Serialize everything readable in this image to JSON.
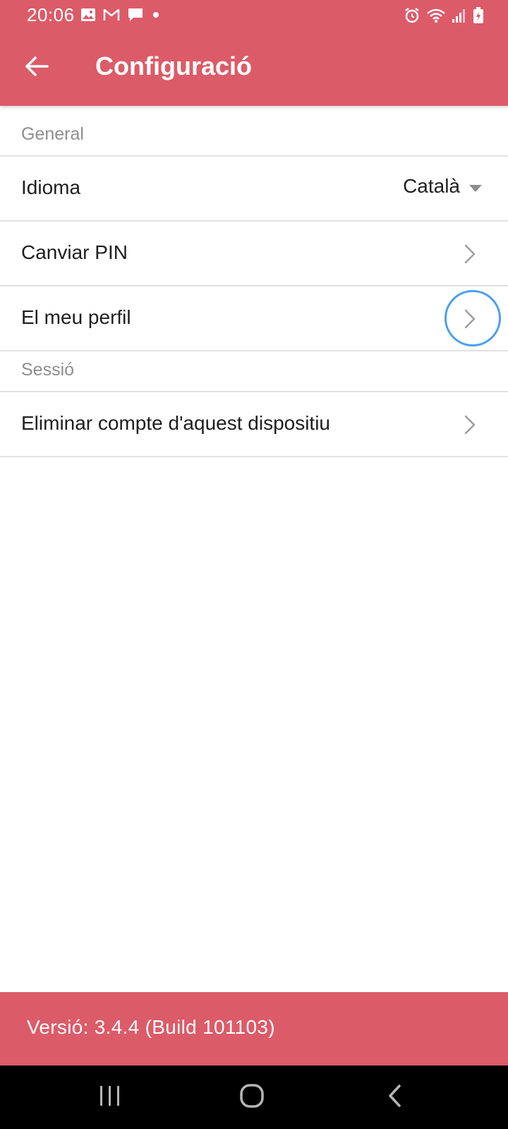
{
  "status_bar": {
    "time": "20:06",
    "left_icons": [
      "image-icon",
      "gmail-icon",
      "message-icon",
      "dot-icon"
    ],
    "right_icons": [
      "alarm-icon",
      "wifi-icon",
      "signal-icon",
      "battery-icon"
    ]
  },
  "app_bar": {
    "title": "Configuració",
    "back_icon": "arrow-left-icon"
  },
  "sections": {
    "general": {
      "header": "General",
      "language": {
        "label": "Idioma",
        "value": "Català"
      },
      "change_pin": {
        "label": "Canviar PIN"
      },
      "my_profile": {
        "label": "El meu perfil"
      }
    },
    "session": {
      "header": "Sessió",
      "remove_account": {
        "label": "Eliminar compte d'aquest dispositiu"
      }
    }
  },
  "footer": {
    "version_text": "Versió: 3.4.4 (Build 101103)"
  },
  "nav_bar": {
    "icons": [
      "recent-apps-icon",
      "home-icon",
      "back-icon"
    ]
  },
  "colors": {
    "primary": "#dc5b68",
    "touch_indicator": "#4a9ff0",
    "divider": "#e2e2e2",
    "section_header_text": "#8e8e8e"
  }
}
